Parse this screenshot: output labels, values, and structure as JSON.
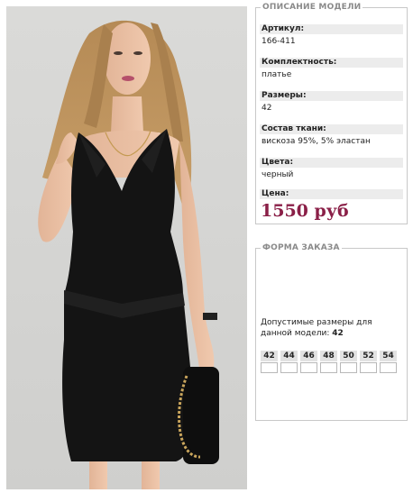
{
  "description": {
    "legend": "ОПИСАНИЕ МОДЕЛИ",
    "fields": [
      {
        "label": "Артикул:",
        "value": "166-411"
      },
      {
        "label": "Комплектность:",
        "value": "платье"
      },
      {
        "label": "Размеры:",
        "value": "42"
      },
      {
        "label": "Состав ткани:",
        "value": "вискоза 95%, 5% эластан"
      },
      {
        "label": "Цвета:",
        "value": "черный"
      }
    ],
    "price_label": "Цена:",
    "price": "1550 руб"
  },
  "order": {
    "legend": "ФОРМА ЗАКАЗА",
    "allowed_text": "Допустимые размеры для данной модели:",
    "allowed_value": "42",
    "sizes": [
      "42",
      "44",
      "46",
      "48",
      "50",
      "52",
      "54"
    ]
  },
  "colors": {
    "price": "#8a1f47",
    "label_bg": "#ececec",
    "photo_bg": "#d4d4d2",
    "dress": "#141414"
  }
}
